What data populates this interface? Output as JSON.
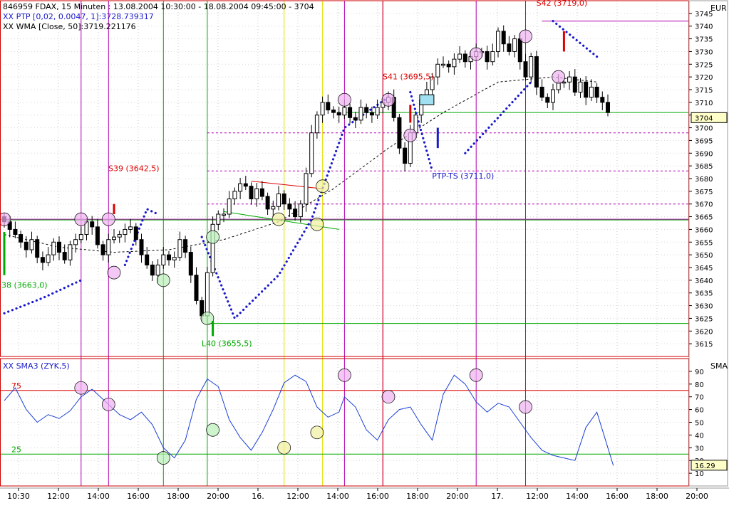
{
  "header": {
    "line1": "846959 FDAX, 15 Minuten : 13.08.2004 10:30:00 - 18.08.2004 09:45:00 - 3704",
    "line2": "XX PTP [0,02, 0.0047, 1]:3728.739317",
    "line3": "XX WMA [Close, 50]:3719.221176",
    "lower_label": "XX    SMA3 (ZYK,5)"
  },
  "axis": {
    "upper_unit": "EUR",
    "lower_unit": "SMA",
    "last_price_label": "3704",
    "last_osc_label": "16.29"
  },
  "colors": {
    "frame": "#cc0000",
    "candle": "#000000",
    "psar": "#1a1acc",
    "wma": "#000000",
    "osc": "#1a3fd6",
    "magenta": "#b000b0",
    "green": "#00aa00",
    "yellow": "#e0e000",
    "red": "#dd0000"
  },
  "chart_data": [
    {
      "type": "candlestick",
      "title": "846959 FDAX, 15 Minuten : 13.08.2004 10:30:00 - 18.08.2004 09:45:00 - 3704",
      "xlabel": "",
      "ylabel": "EUR",
      "ylim": [
        3610,
        3750
      ],
      "yticks": [
        3615,
        3620,
        3625,
        3630,
        3635,
        3640,
        3645,
        3650,
        3655,
        3660,
        3665,
        3670,
        3675,
        3680,
        3685,
        3690,
        3695,
        3700,
        3705,
        3710,
        3715,
        3720,
        3725,
        3730,
        3735,
        3740,
        3745
      ],
      "xticks": [
        "10:30",
        "12:00",
        "14:00",
        "16:00",
        "18:00",
        "20:00",
        "16.",
        "12:00",
        "14:00",
        "16:00",
        "18:00",
        "20:00",
        "17.",
        "12:00",
        "14:00",
        "16:00",
        "18:00",
        "20:00"
      ],
      "grid": true,
      "close": [
        3663,
        3660,
        3658,
        3655,
        3652,
        3656,
        3649,
        3647,
        3650,
        3655,
        3651,
        3648,
        3654,
        3656,
        3658,
        3663,
        3661,
        3654,
        3650,
        3656,
        3657,
        3658,
        3660,
        3661,
        3656,
        3650,
        3646,
        3642,
        3646,
        3650,
        3648,
        3649,
        3656,
        3651,
        3642,
        3632,
        3626,
        3643,
        3662,
        3666,
        3666,
        3672,
        3675,
        3678,
        3677,
        3672,
        3676,
        3673,
        3668,
        3669,
        3674,
        3670,
        3668,
        3665,
        3670,
        3682,
        3698,
        3705,
        3710,
        3707,
        3706,
        3705,
        3708,
        3704,
        3703,
        3708,
        3706,
        3705,
        3708,
        3710,
        3712,
        3704,
        3692,
        3686,
        3698,
        3705,
        3711,
        3715,
        3720,
        3725,
        3725,
        3724,
        3727,
        3729,
        3726,
        3728,
        3730,
        3730,
        3726,
        3730,
        3738,
        3733,
        3730,
        3735,
        3726,
        3720,
        3728,
        3716,
        3712,
        3710,
        3715,
        3718,
        3718,
        3720,
        3714,
        3718,
        3712,
        3716,
        3712,
        3710,
        3706
      ],
      "series": [
        {
          "name": "XX PTP [0,02, 0.0047, 1]:3728.739317",
          "x": [
            0,
            7,
            14,
            22,
            26,
            28,
            36,
            42,
            50,
            56,
            62,
            70,
            74,
            78,
            84,
            96,
            100,
            108
          ],
          "y": [
            3627,
            3633,
            3640,
            3646,
            3668,
            3666,
            3657,
            3625,
            3642,
            3664,
            3700,
            3712,
            3714,
            3683,
            3690,
            3718,
            3742,
            3728
          ]
        },
        {
          "name": "XX WMA [Close, 50]:3719.221176",
          "x": [
            0,
            10,
            20,
            30,
            40,
            50,
            60,
            70,
            80,
            90,
            100,
            108
          ],
          "y": [
            3658,
            3653,
            3651,
            3652,
            3656,
            3663,
            3676,
            3692,
            3706,
            3718,
            3720,
            3718
          ]
        }
      ],
      "annotations": [
        {
          "text": "S39 (3642,5)",
          "color": "red",
          "bar": 23
        },
        {
          "text": "S41 (3695,5)",
          "color": "red",
          "bar": 70
        },
        {
          "text": "S42 (3719,0)",
          "color": "red",
          "bar": 98
        },
        {
          "text": "38 (3663,0)",
          "color": "green",
          "bar": 0
        },
        {
          "text": "L40 (3655,5)",
          "color": "green",
          "bar": 37
        },
        {
          "text": "PTP-TS (3711,0)",
          "color": "blue",
          "bar": 79
        }
      ],
      "hlines": [
        3664,
        3706,
        3698,
        3683,
        3670,
        3623
      ],
      "vlines": {
        "magenta": [
          14,
          19,
          62,
          69,
          86,
          95
        ],
        "green": [
          29,
          37
        ],
        "yellow": [
          51,
          58
        ],
        "red": [
          69
        ]
      }
    },
    {
      "type": "line",
      "title": "XX    SMA3 (ZYK,5)",
      "xlabel": "",
      "ylabel": "SMA",
      "ylim": [
        0,
        100
      ],
      "yticks": [
        10,
        20,
        30,
        40,
        50,
        60,
        70,
        80,
        90
      ],
      "grid": true,
      "levels": [
        {
          "value": 75,
          "label": "75"
        },
        {
          "value": 25,
          "label": "25"
        }
      ],
      "series": [
        {
          "name": "SMA3 (ZYK,5)",
          "x": [
            0,
            2,
            4,
            6,
            8,
            10,
            12,
            14,
            16,
            18,
            19,
            21,
            23,
            25,
            27,
            29,
            31,
            33,
            35,
            37,
            39,
            41,
            43,
            45,
            47,
            49,
            51,
            53,
            55,
            57,
            59,
            61,
            62,
            64,
            66,
            68,
            70,
            72,
            74,
            76,
            78,
            80,
            82,
            84,
            86,
            88,
            90,
            92,
            94,
            96,
            98,
            100,
            102,
            104,
            106,
            108,
            110,
            111
          ],
          "y": [
            67,
            77,
            60,
            50,
            56,
            53,
            59,
            70,
            76,
            68,
            64,
            56,
            52,
            58,
            48,
            30,
            22,
            36,
            68,
            84,
            78,
            52,
            38,
            28,
            42,
            60,
            81,
            87,
            82,
            62,
            54,
            58,
            70,
            62,
            44,
            36,
            52,
            60,
            62,
            48,
            36,
            72,
            87,
            80,
            66,
            58,
            65,
            62,
            50,
            38,
            28,
            24,
            22,
            20,
            46,
            58,
            30,
            16
          ]
        }
      ]
    }
  ]
}
